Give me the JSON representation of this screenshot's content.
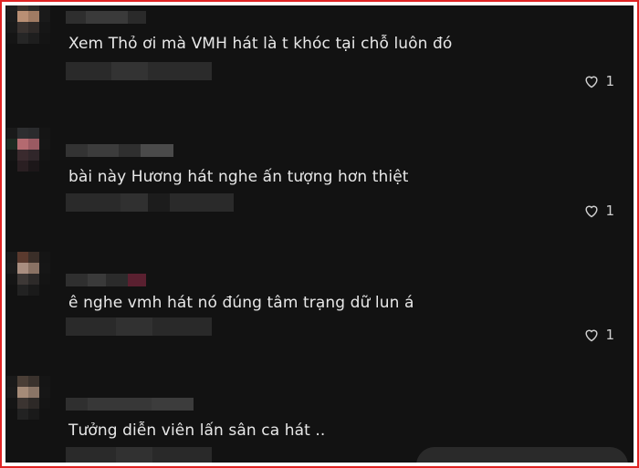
{
  "comments": [
    {
      "text": "Xem Thỏ ơi mà VMH hát là t khóc tại chỗ luôn đó",
      "likes": "1"
    },
    {
      "text": "bài này Hương hát nghe ấn tượng hơn thiệt",
      "likes": "1"
    },
    {
      "text": "ê nghe vmh hát nó đúng tâm trạng dữ lun á",
      "likes": "1"
    },
    {
      "text": "Tưởng diễn viên lấn sân ca hát ..",
      "likes": ""
    }
  ],
  "icons": {
    "like": "heart-outline-icon"
  },
  "colors": {
    "background": "#121212",
    "text": "#e8e8e8",
    "frame": "#e02424"
  }
}
